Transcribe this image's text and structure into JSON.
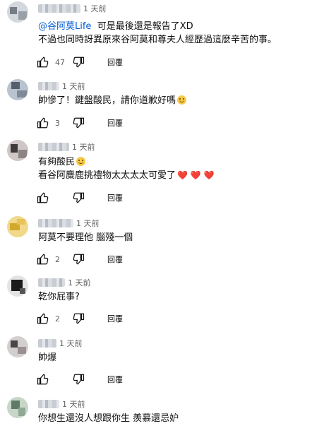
{
  "comments": [
    {
      "time": "1 天前",
      "mention": "@谷阿莫Life",
      "line1": "可是最後還是報告了XD",
      "line2": "不過也同時訝異原來谷阿莫和尊夫人經歷過這麼辛苦的事。",
      "likes": "47",
      "reply": "回覆"
    },
    {
      "time": "1 天前",
      "line1": "帥慘了！鍵盤酸民，請你道歉好嗎",
      "emoji": "smiling-face-emoji",
      "likes": "3",
      "reply": "回覆"
    },
    {
      "time": "1 天前",
      "line1": "有夠酸民",
      "line2": "看谷阿麋鹿挑禮物太太太太可愛了",
      "hearts": "❤️ ❤️ ❤️",
      "likes": "",
      "reply": "回覆"
    },
    {
      "time": "1 天前",
      "line1": "阿莫不要理他 腦殘一個",
      "likes": "2",
      "reply": "回覆"
    },
    {
      "time": "1 天前",
      "line1": "乾你屁事?",
      "likes": "2",
      "reply": "回覆"
    },
    {
      "time": "1 天前",
      "line1": "帥爆",
      "likes": "",
      "reply": "回覆"
    },
    {
      "time": "1 天前",
      "line1": "你想生還沒人想跟你生 羨慕還忌妒",
      "likes": "",
      "reply": "回覆"
    }
  ],
  "colors": {
    "mention": "#065fd4",
    "meta": "#606060"
  },
  "icons": {
    "like": "thumb-up-icon",
    "dislike": "thumb-down-icon"
  }
}
